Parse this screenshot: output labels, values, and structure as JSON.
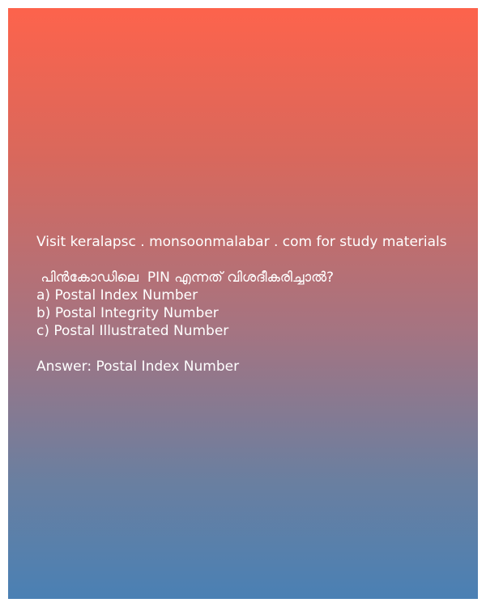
{
  "post": {
    "visit_line": "Visit keralapsc . monsoonmalabar . com for study materials",
    "question": " പിന്‍കോഡിലെ  PIN എന്നത് വിശദീകരിച്ചാല്‍?",
    "options": [
      "a) Postal Index Number",
      "b) Postal Integrity Number",
      "c) Postal Illustrated Number"
    ],
    "answer": "Answer: Postal Index Number"
  },
  "colors": {
    "gradient_top": "#fd634c",
    "gradient_bottom": "#4a80b4",
    "text": "#ffffff"
  }
}
